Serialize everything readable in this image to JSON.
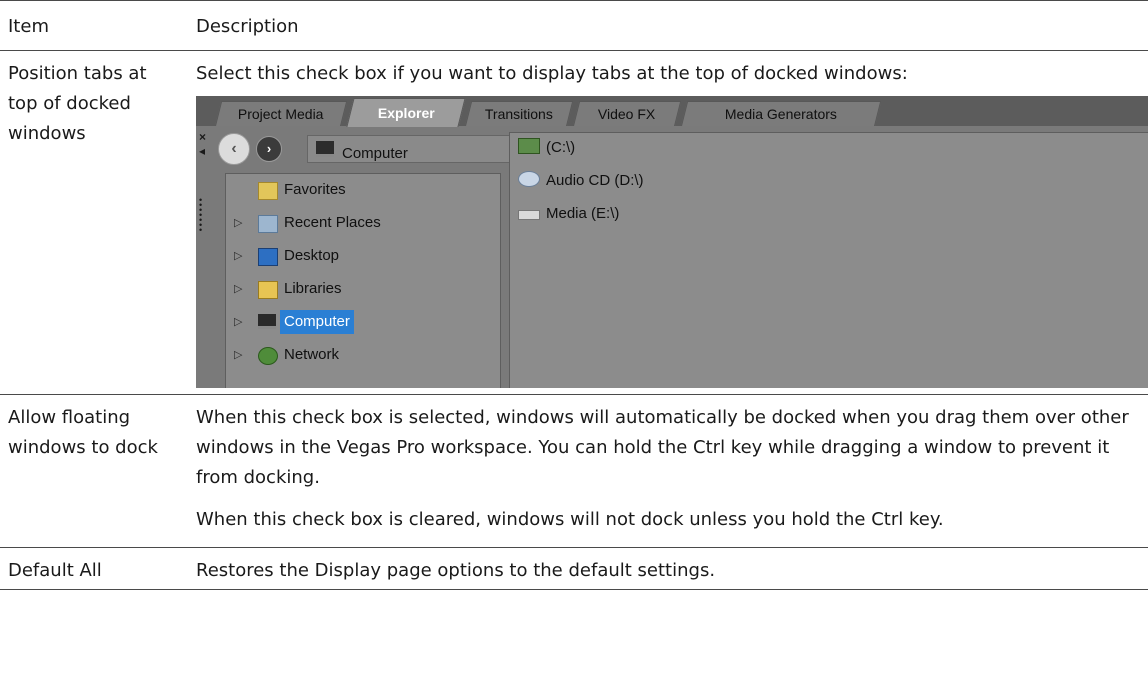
{
  "table": {
    "header": {
      "item": "Item",
      "description": "Description"
    },
    "rows": [
      {
        "item": "Position tabs at top of docked windows",
        "description": "Select this check box if you want to display tabs at the top of docked windows:"
      },
      {
        "item": "Allow floating windows to dock",
        "description": "When this check box is selected, windows will automatically be docked when you drag them over other windows in the Vegas Pro workspace. You can hold the Ctrl key while dragging a window to prevent it from docking.",
        "description2": "When this check box is cleared, windows will not dock unless you hold the Ctrl key."
      },
      {
        "item": "Default All",
        "description": "Restores the Display page options to the default settings."
      }
    ]
  },
  "screenshot": {
    "tabs": [
      "Project Media",
      "Explorer",
      "Transitions",
      "Video FX",
      "Media Generators"
    ],
    "active_tab": "Explorer",
    "address": "Computer",
    "tree": [
      {
        "label": "Favorites",
        "icon": "favorites-icon"
      },
      {
        "label": "Recent Places",
        "icon": "recent-places-icon"
      },
      {
        "label": "Desktop",
        "icon": "desktop-icon"
      },
      {
        "label": "Libraries",
        "icon": "libraries-icon"
      },
      {
        "label": "Computer",
        "icon": "computer-icon"
      },
      {
        "label": "Network",
        "icon": "network-icon"
      }
    ],
    "selected_tree_item": "Computer",
    "drives": [
      {
        "label": "(C:\\)",
        "icon": "local-disk-icon"
      },
      {
        "label": "Audio CD (D:\\)",
        "icon": "cd-drive-icon"
      },
      {
        "label": "Media (E:\\)",
        "icon": "removable-drive-icon"
      }
    ],
    "colors": {
      "selection": "#2a7fd4",
      "panel": "#8c8c8c",
      "frame": "#7a7a7a"
    }
  }
}
